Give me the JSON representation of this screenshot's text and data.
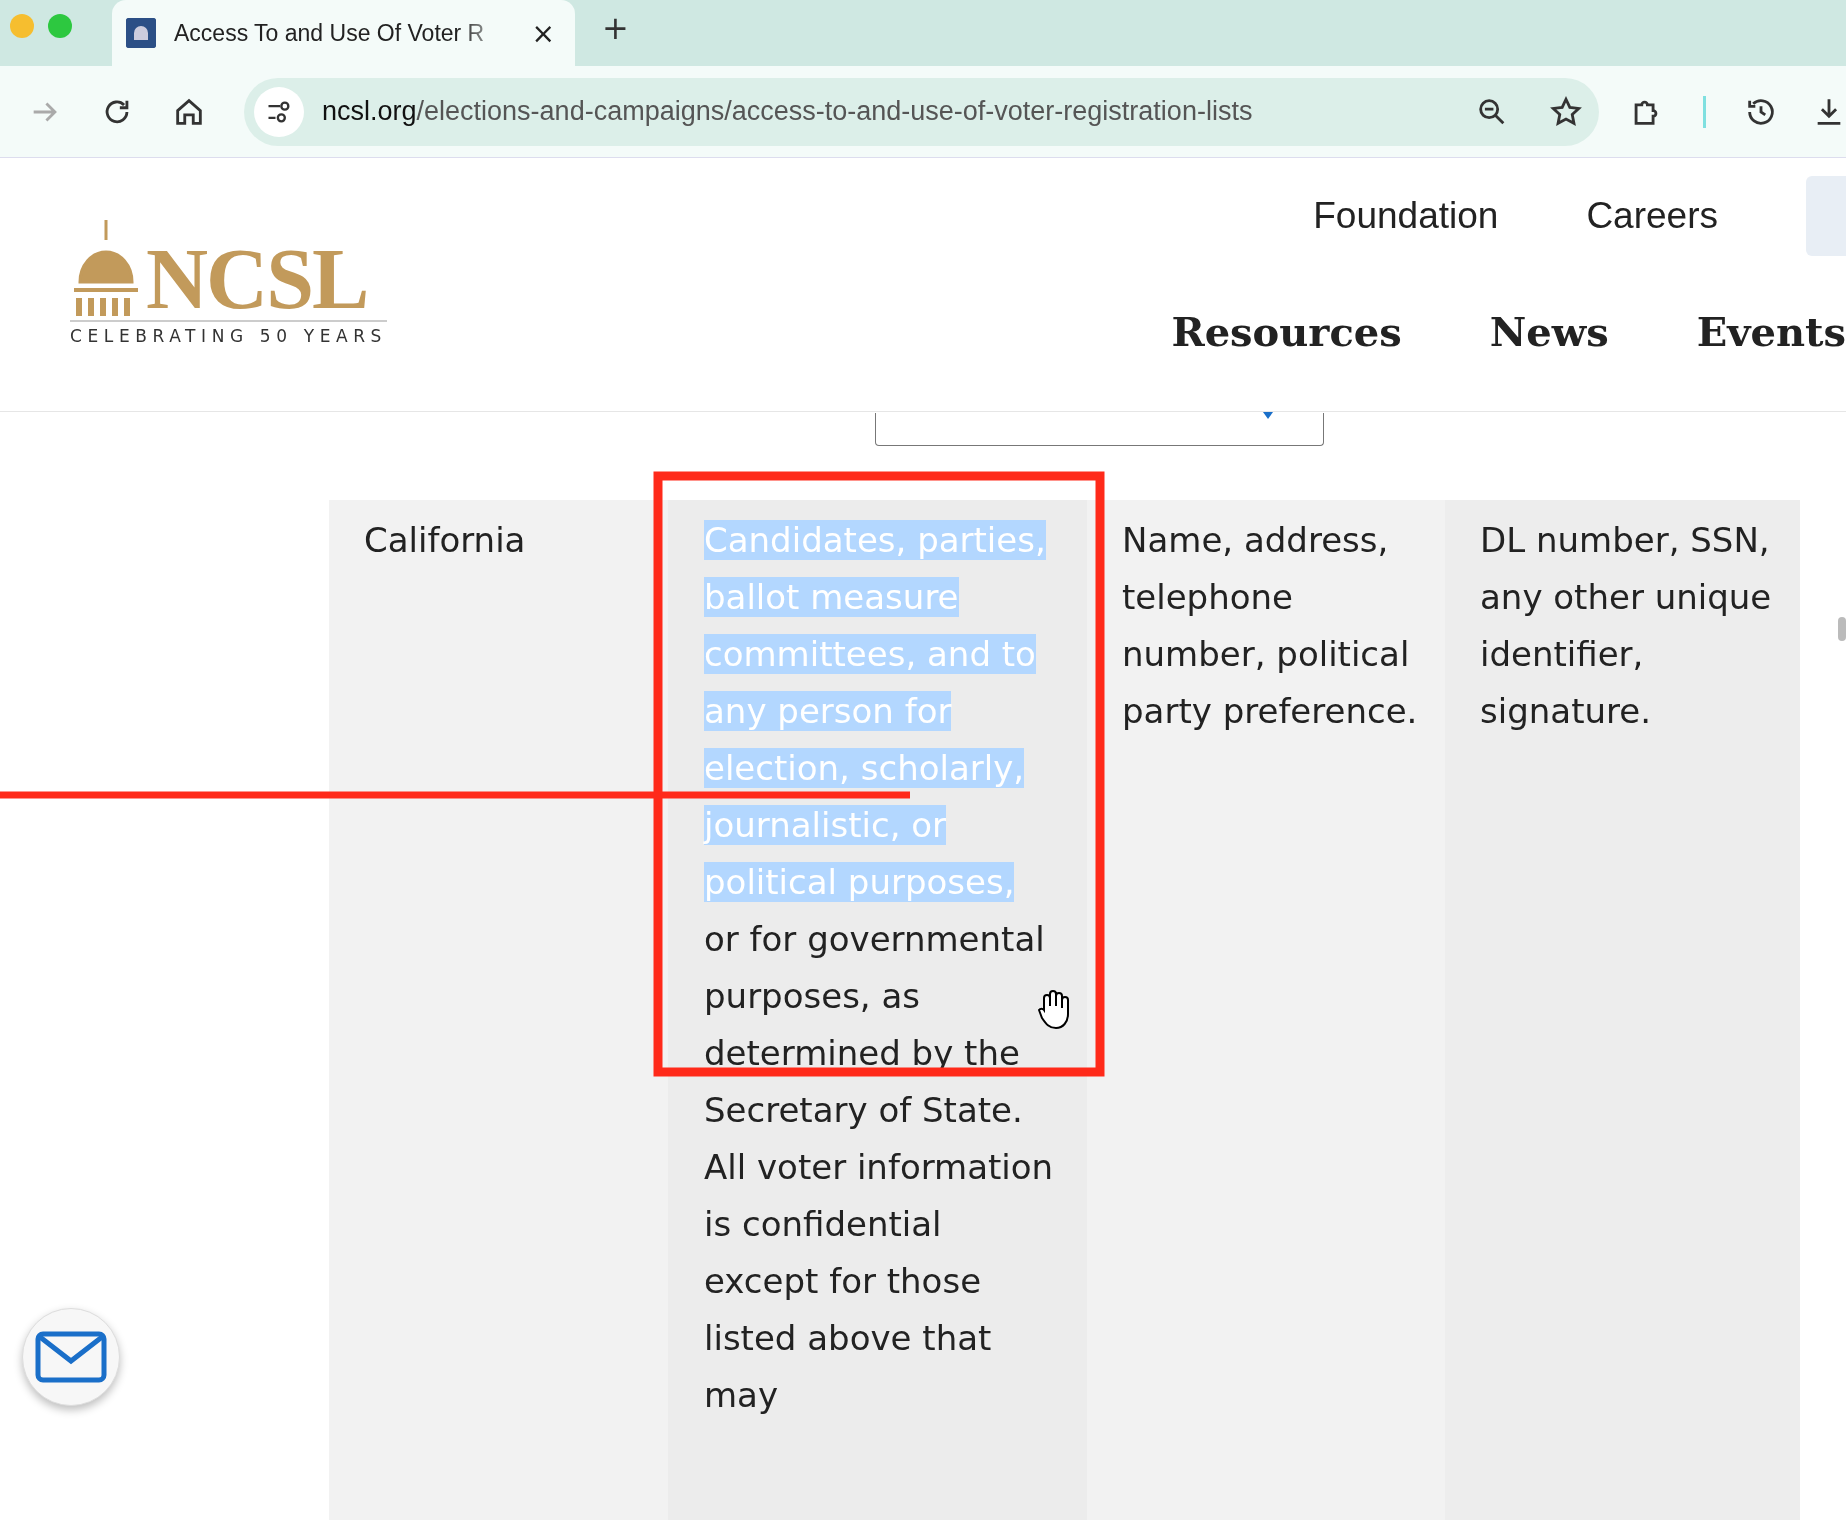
{
  "browser": {
    "tab": {
      "title": "Access To and Use Of Voter R",
      "close": "×"
    },
    "new_tab": "+",
    "forward": {
      "disabled": true
    },
    "url": {
      "host": "ncsl.org",
      "path": "/elections-and-campaigns/access-to-and-use-of-voter-registration-lists"
    }
  },
  "header": {
    "logo": {
      "name": "NCSL",
      "tagline": "CELEBRATING 50 YEARS"
    },
    "top_links": [
      "Foundation",
      "Careers"
    ],
    "main_nav": [
      "Resources",
      "News",
      "Events"
    ]
  },
  "table": {
    "row": {
      "state": "California",
      "recipients": {
        "highlighted": "Candidates, parties, ballot measure committees, and to any person for election, scholarly, journalistic, or political purposes,",
        "rest": "or for governmental purposes, as determined by the Secretary of State. All voter information is confidential except for those listed above that may"
      },
      "available": "Name, address, telephone number, political party preference.",
      "restricted": "DL number, SSN, any other unique identifier, signature."
    }
  }
}
